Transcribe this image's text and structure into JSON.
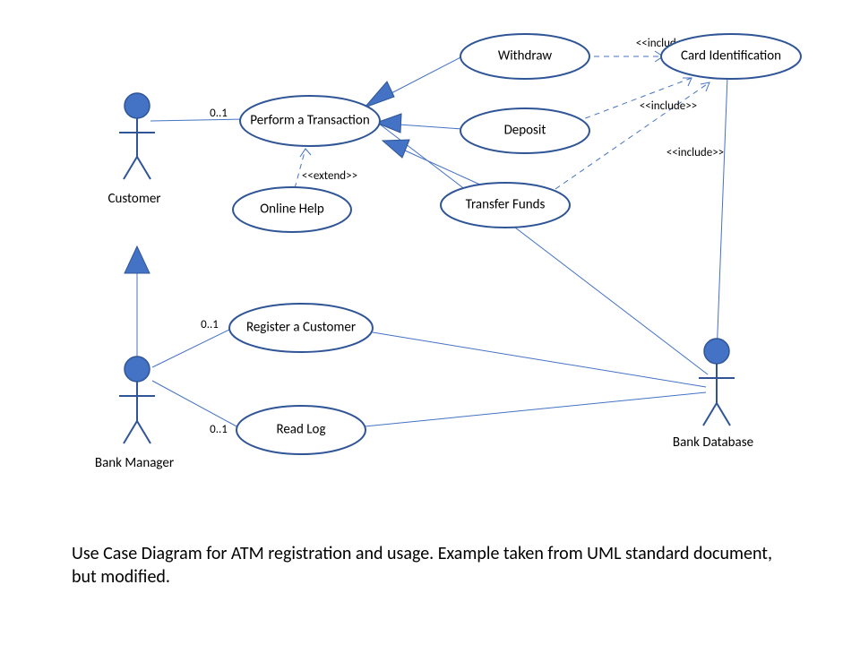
{
  "actors": {
    "customer": "Customer",
    "bank_manager": "Bank Manager",
    "bank_database": "Bank Database"
  },
  "usecases": {
    "perform_transaction": "Perform  a Transaction",
    "withdraw": "Withdraw",
    "deposit": "Deposit",
    "transfer_funds": "Transfer Funds",
    "online_help": "Online Help",
    "card_identification": "Card Identification",
    "register_customer": "Register a Customer",
    "read_log": "Read Log"
  },
  "annotations": {
    "extend": "<<extend>>",
    "include1": "<<include>>",
    "include2": "<<include>>",
    "include3": "<<include>>",
    "mult1": "0..1",
    "mult2": "0..1",
    "mult3": "0..1"
  },
  "caption": "Use Case Diagram for ATM registration and usage. Example taken from UML standard document, but modified."
}
